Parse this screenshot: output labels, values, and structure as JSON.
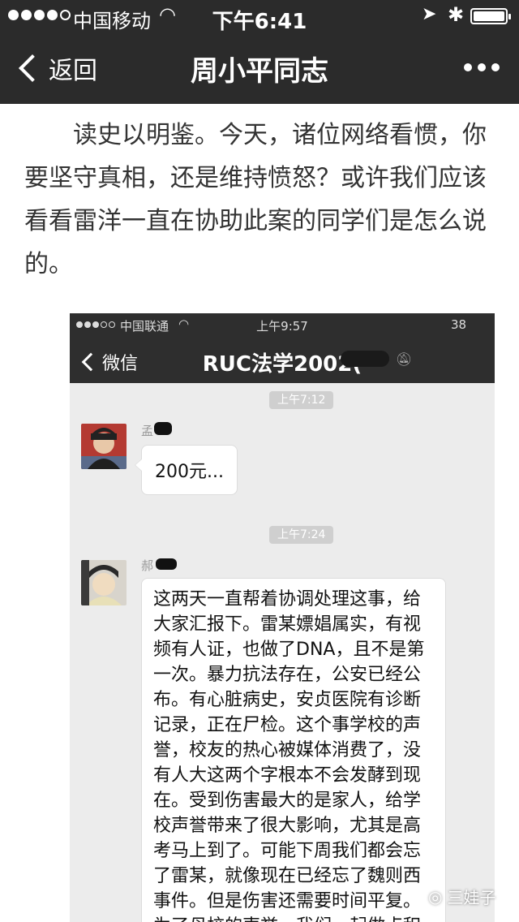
{
  "status_bar": {
    "carrier": "中国移动",
    "time": "下午6:41"
  },
  "nav": {
    "back_label": "返回",
    "title": "周小平同志"
  },
  "article": {
    "paragraph": "读史以明鉴。今天，诸位网络看惯，你要坚守真相，还是维持愤怒？或许我们应该看看雷洋一直在协助此案的同学们是怎么说的。"
  },
  "screenshot": {
    "status_bar": {
      "carrier": "中国联通",
      "time": "上午9:57",
      "battery": "38"
    },
    "nav": {
      "back_label": "微信",
      "title": "RUC法学2002("
    },
    "messages": [
      {
        "timestamp": "上午7:12",
        "sender_visible": "孟",
        "text": "200元..."
      },
      {
        "timestamp": "上午7:24",
        "sender_visible": "郝",
        "text": "这两天一直帮着协调处理这事，给大家汇报下。雷某嫖娼属实，有视频有人证，也做了DNA，且不是第一次。暴力抗法存在，公安已经公布。有心脏病史，安贞医院有诊断记录，正在尸检。这个事学校的声誉，校友的热心被媒体消费了，没有人大这两个字根本不会发酵到现在。受到伤害最大的是家人，给学校声誉带来了很大影响，尤其是高考马上到了。可能下周我们都会忘了雷某，就像现在已经忘了魏则西事件。但是伤害还需要时间平复。为了母校的声誉，我们一起做点积极的事"
      }
    ]
  },
  "watermark": {
    "text": "三娃子"
  }
}
